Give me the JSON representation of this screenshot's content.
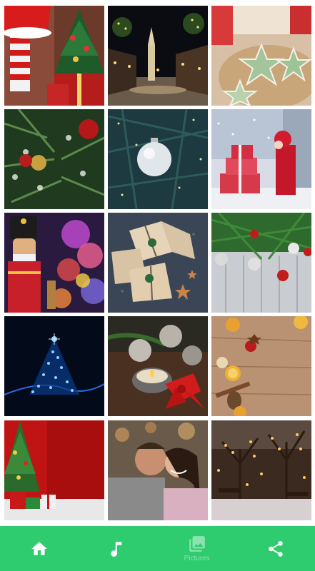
{
  "gallery": {
    "tiles": [
      {
        "name": "santa-stockings-tree-photo"
      },
      {
        "name": "christmas-street-night-photo"
      },
      {
        "name": "star-cookies-photo"
      },
      {
        "name": "tree-ornaments-photo"
      },
      {
        "name": "silver-bauble-photo"
      },
      {
        "name": "snowy-gifts-girl-photo"
      },
      {
        "name": "nutcracker-bokeh-photo"
      },
      {
        "name": "wrapped-gifts-photo"
      },
      {
        "name": "pine-wood-background-photo"
      },
      {
        "name": "blue-light-tree-photo"
      },
      {
        "name": "candle-baubles-photo"
      },
      {
        "name": "wood-oranges-spices-photo"
      },
      {
        "name": "red-background-tree-photo"
      },
      {
        "name": "couple-kiss-photo"
      },
      {
        "name": "snowy-park-lights-photo"
      }
    ]
  },
  "nav": {
    "home_icon": "home-icon",
    "music_icon": "music-note-icon",
    "photos_icon": "photos-icon",
    "photos_label": "Pictures",
    "share_icon": "share-icon",
    "bar_color": "#2ecc6e"
  }
}
